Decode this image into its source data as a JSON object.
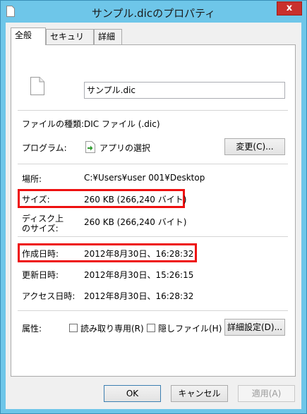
{
  "window": {
    "title": "サンプル.dicのプロパティ",
    "close_glyph": "x"
  },
  "tabs": [
    {
      "label": "全般",
      "active": true
    },
    {
      "label": "セキュリティ",
      "active": false
    },
    {
      "label": "詳細",
      "active": false
    }
  ],
  "general": {
    "file_name": "サンプル.dic",
    "file_type_label": "ファイルの種類:",
    "file_type_value": "DIC ファイル (.dic)",
    "program_label": "プログラム:",
    "program_value": "アプリの選択",
    "change_button": "変更(C)...",
    "location_label": "場所:",
    "location_value": "C:¥Users¥user 001¥Desktop",
    "size_label": "サイズ:",
    "size_value": "260 KB (266,240 バイト)",
    "disk_size_label_line1": "ディスク上",
    "disk_size_label_line2": "のサイズ:",
    "disk_size_value": "260 KB (266,240 バイト)",
    "created_label": "作成日時:",
    "created_value": "2012年8月30日、16:28:32",
    "modified_label": "更新日時:",
    "modified_value": "2012年8月30日、15:26:15",
    "accessed_label": "アクセス日時:",
    "accessed_value": "2012年8月30日、16:28:32",
    "attributes_label": "属性:",
    "readonly_label": "読み取り専用(R)",
    "readonly_checked": false,
    "hidden_label": "隠しファイル(H)",
    "hidden_checked": false,
    "advanced_button": "詳細設定(D)..."
  },
  "footer": {
    "ok": "OK",
    "cancel": "キャンセル",
    "apply": "適用(A)"
  },
  "colors": {
    "title_bar": "#6ec6e9",
    "highlight_box": "#ee1010",
    "close_button": "#c9302c",
    "default_button_border": "#3c7fb1"
  }
}
